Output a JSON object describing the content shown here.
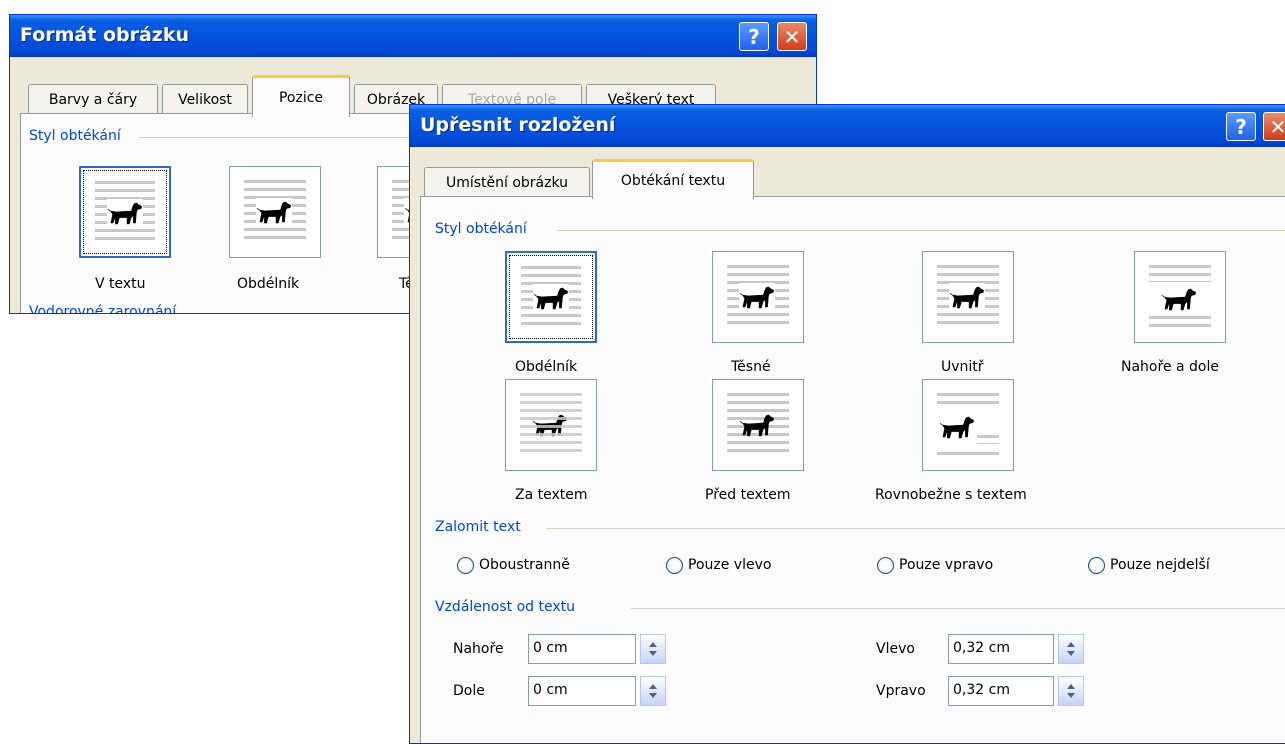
{
  "dialog_back": {
    "title": "Formát obrázku",
    "help_label": "?",
    "close_label": "✕",
    "tabs": [
      "Barvy a čáry",
      "Velikost",
      "Pozice",
      "Obrázek",
      "Textové pole",
      "Veškerý text"
    ],
    "active_tab": "Pozice",
    "disabled_tab": "Textové pole",
    "group_wrap_style": "Styl obtékání",
    "wrap_options": [
      "V textu",
      "Obdélník",
      "Tě"
    ],
    "group_horizontal_alignment": "Vodorovné zarovnání"
  },
  "dialog_front": {
    "title": "Upřesnit rozložení",
    "help_label": "?",
    "close_label": "✕",
    "tabs": [
      "Umístění obrázku",
      "Obtékání textu"
    ],
    "active_tab": "Obtékání textu",
    "group_wrap_style": "Styl obtékání",
    "wrap_options": [
      "Obdélník",
      "Těsné",
      "Uvnitř",
      "Nahoře a dole",
      "Za textem",
      "Před textem",
      "Rovnobežne s textem"
    ],
    "selected_wrap_option": "Obdélník",
    "group_wrap_text": "Zalomit text",
    "wrap_text_options": [
      "Oboustranně",
      "Pouze vlevo",
      "Pouze vpravo",
      "Pouze nejdelší"
    ],
    "group_distance": "Vzdálenost od textu",
    "distance": {
      "top_label": "Nahoře",
      "top_value": "0 cm",
      "bottom_label": "Dole",
      "bottom_value": "0 cm",
      "left_label": "Vlevo",
      "left_value": "0,32 cm",
      "right_label": "Vpravo",
      "right_value": "0,32 cm"
    }
  },
  "colors": {
    "title_bar": "#0554e0",
    "dialog_face": "#ece9d8",
    "group_title": "#0046d5",
    "tab_highlight": "#ffc83c",
    "selection": "#316ac5"
  },
  "icons": [
    "dog-icon",
    "help-icon",
    "close-icon",
    "spin-up-icon",
    "spin-down-icon"
  ]
}
